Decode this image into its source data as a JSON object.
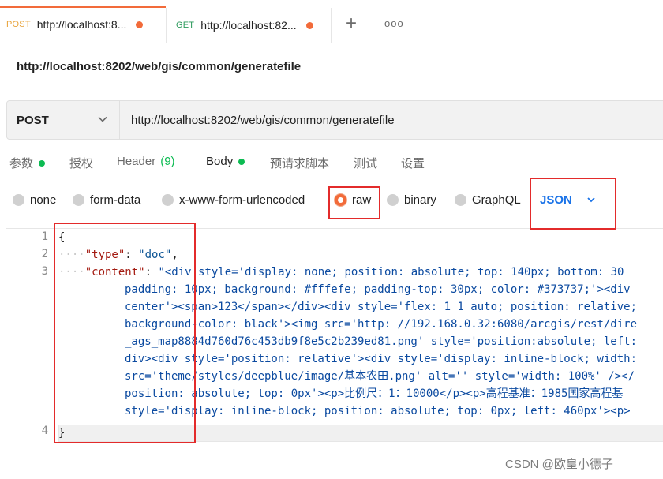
{
  "tabs": [
    {
      "method": "POST",
      "title": "http://localhost:8..."
    },
    {
      "method": "GET",
      "title": "http://localhost:82..."
    }
  ],
  "tab_actions": {
    "add": "+",
    "more": "ooo"
  },
  "request_title": "http://localhost:8202/web/gis/common/generatefile",
  "urlbar": {
    "method": "POST",
    "url": "http://localhost:8202/web/gis/common/generatefile"
  },
  "request_tabs": [
    {
      "label": "参数"
    },
    {
      "label": "授权"
    },
    {
      "label": "Header",
      "count": "(9)"
    },
    {
      "label": "Body"
    },
    {
      "label": "预请求脚本"
    },
    {
      "label": "测试"
    },
    {
      "label": "设置"
    }
  ],
  "body_types": [
    "none",
    "form-data",
    "x-www-form-urlencoded",
    "raw",
    "binary",
    "GraphQL"
  ],
  "selected_body_type": "raw",
  "raw_format": "JSON",
  "line_numbers": [
    "1",
    "2",
    "3",
    "4"
  ],
  "code": {
    "open_brace": "{",
    "type_key": "\"type\"",
    "type_value": "\"doc\"",
    "content_key": "\"content\"",
    "content_lines": [
      "\"<div style='display: none; position: absolute; top: 140px; bottom: 30",
      "padding: 10px; background: #fffefe; padding-top: 30px; color: #373737;'><div",
      "center'><span>123</span></div><div style='flex: 1 1 auto; position: relative;",
      "background-color: black'><img src='http: //192.168.0.32:6080/arcgis/rest/dire",
      "_ags_map8884d760d76c453db9f8e5c2b239ed81.png' style='position:absolute; left:",
      "div><div style='position: relative'><div style='display: inline-block; width:",
      "src='theme/styles/deepblue/image/基本农田.png' alt='' style='width: 100%' /></",
      "position: absolute; top: 0px'><p>比例尺：1：10000</p><p>高程基准：1985国家高程基",
      "style='display: inline-block; position: absolute; top: 0px; left: 460px'><p>"
    ],
    "close_brace": "}"
  },
  "watermark": "CSDN @欧皇小德子",
  "colors": {
    "accent": "#f26b3a",
    "success": "#0cbb52",
    "link": "#1a73e8",
    "annotation": "#e32b2b"
  }
}
